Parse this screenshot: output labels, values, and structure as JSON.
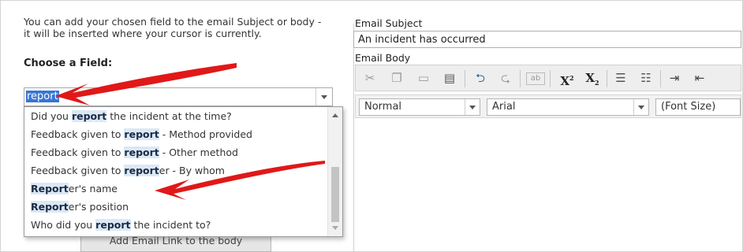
{
  "left": {
    "help_text": "You can add your chosen field to the email Subject or body - it will be inserted where your cursor is currently.",
    "choose_label": "Choose a Field:",
    "field_value": "report",
    "dropdown_options": [
      {
        "before": "Did you ",
        "match": "report",
        "after": " the incident at the time?"
      },
      {
        "before": "Feedback given to ",
        "match": "report",
        "after": " - Method provided"
      },
      {
        "before": "Feedback given to ",
        "match": "report",
        "after": " - Other method"
      },
      {
        "before": "Feedback given to ",
        "match": "report",
        "after": "er - By whom"
      },
      {
        "before": "",
        "match": "Report",
        "after": "er's name"
      },
      {
        "before": "",
        "match": "Report",
        "after": "er's position"
      },
      {
        "before": "Who did you ",
        "match": "report",
        "after": " the incident to?"
      }
    ],
    "add_link_button": "Add Email Link to the body"
  },
  "right": {
    "subject_label": "Email Subject",
    "subject_value": "An incident has occurred",
    "body_label": "Email Body",
    "toolbar_icons": [
      "cut-icon",
      "copy-icon",
      "paste-icon",
      "paste-word-icon",
      "undo-icon",
      "redo-icon",
      "spellcheck-icon",
      "superscript-icon",
      "subscript-icon",
      "numbered-list-icon",
      "bulleted-list-icon",
      "indent-icon",
      "outdent-icon"
    ],
    "format_value": "Normal",
    "font_value": "Arial",
    "size_value": "(Font Size)"
  },
  "annotation_color": "#e01818",
  "highlight_color": "#3875d7"
}
